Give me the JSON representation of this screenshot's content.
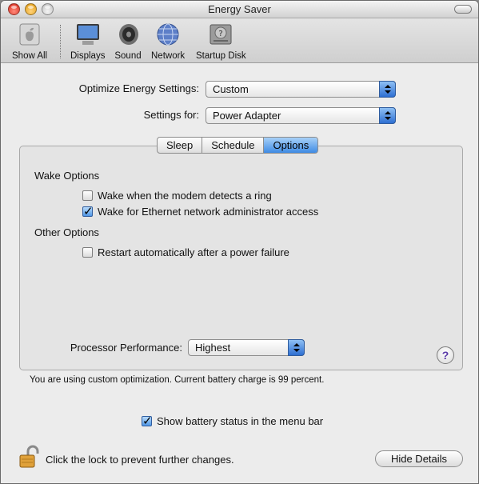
{
  "window": {
    "title": "Energy Saver"
  },
  "toolbar": {
    "items": [
      {
        "label": "Show All",
        "icon": "apple-icon"
      },
      {
        "label": "Displays",
        "icon": "display-icon"
      },
      {
        "label": "Sound",
        "icon": "speaker-icon"
      },
      {
        "label": "Network",
        "icon": "globe-icon"
      },
      {
        "label": "Startup Disk",
        "icon": "disk-icon"
      }
    ]
  },
  "optimize": {
    "label": "Optimize Energy Settings:",
    "value": "Custom"
  },
  "settings_for": {
    "label": "Settings for:",
    "value": "Power Adapter"
  },
  "tabs": [
    {
      "label": "Sleep",
      "selected": false
    },
    {
      "label": "Schedule",
      "selected": false
    },
    {
      "label": "Options",
      "selected": true
    }
  ],
  "wake_options": {
    "title": "Wake Options",
    "items": [
      {
        "label": "Wake when the modem detects a ring",
        "checked": false
      },
      {
        "label": "Wake for Ethernet network administrator access",
        "checked": true
      }
    ]
  },
  "other_options": {
    "title": "Other Options",
    "items": [
      {
        "label": "Restart automatically after a power failure",
        "checked": false
      }
    ]
  },
  "processor": {
    "label": "Processor Performance:",
    "value": "Highest"
  },
  "help": {
    "glyph": "?"
  },
  "status": {
    "text": "You are using custom optimization. Current battery charge is 99 percent."
  },
  "battery_menu": {
    "label": "Show battery status in the menu bar",
    "checked": true
  },
  "lock": {
    "text": "Click the lock to prevent further changes."
  },
  "hide_details": {
    "label": "Hide Details"
  }
}
